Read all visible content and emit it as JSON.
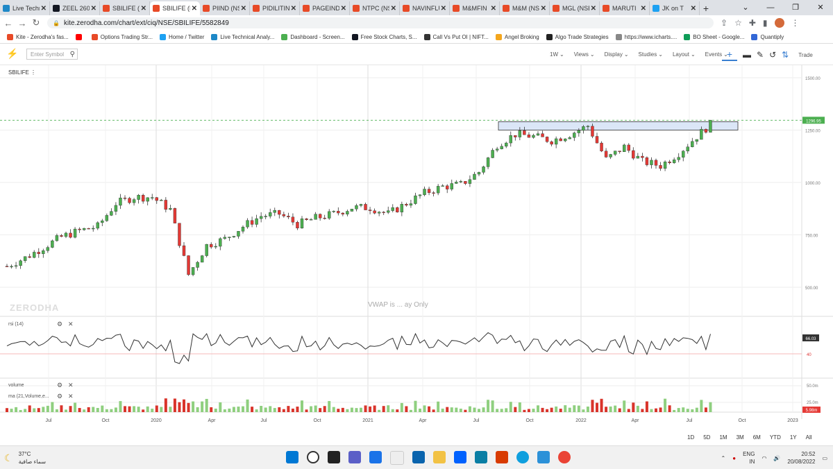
{
  "tabs": [
    {
      "label": "Live Techn",
      "favicon": "bookmark",
      "color": "#1e88c7",
      "active": false
    },
    {
      "label": "ZEEL 260",
      "favicon": "tradingview",
      "color": "#131722",
      "active": false
    },
    {
      "label": "SBILIFE (N",
      "favicon": "kite",
      "color": "#e84a27",
      "active": false
    },
    {
      "label": "SBILIFE (N",
      "favicon": "kite",
      "color": "#e84a27",
      "active": true
    },
    {
      "label": "PIIND (NS",
      "favicon": "kite",
      "color": "#e84a27",
      "active": false
    },
    {
      "label": "PIDILITIN",
      "favicon": "kite",
      "color": "#e84a27",
      "active": false
    },
    {
      "label": "PAGEIND",
      "favicon": "kite",
      "color": "#e84a27",
      "active": false
    },
    {
      "label": "NTPC (NS",
      "favicon": "kite",
      "color": "#e84a27",
      "active": false
    },
    {
      "label": "NAVINFLU",
      "favicon": "kite",
      "color": "#e84a27",
      "active": false
    },
    {
      "label": "M&MFIN",
      "favicon": "kite",
      "color": "#e84a27",
      "active": false
    },
    {
      "label": "M&M (NS",
      "favicon": "kite",
      "color": "#e84a27",
      "active": false
    },
    {
      "label": "MGL (NSE",
      "favicon": "kite",
      "color": "#e84a27",
      "active": false
    },
    {
      "label": "MARUTI",
      "favicon": "kite",
      "color": "#e84a27",
      "active": false
    },
    {
      "label": "JK on T",
      "favicon": "twitter",
      "color": "#1da1f2",
      "active": false
    }
  ],
  "address": {
    "url": "kite.zerodha.com/chart/ext/ciq/NSE/SBILIFE/5582849"
  },
  "bookmarks": [
    {
      "label": "Kite - Zerodha's fas...",
      "color": "#e84a27"
    },
    {
      "label": "",
      "color": "#ff0000"
    },
    {
      "label": "Options Trading Str...",
      "color": "#e84a27"
    },
    {
      "label": "Home / Twitter",
      "color": "#1da1f2"
    },
    {
      "label": "Live Technical Analy...",
      "color": "#1e88c7"
    },
    {
      "label": "Dashboard - Screen...",
      "color": "#4caf50"
    },
    {
      "label": "Free Stock Charts, S...",
      "color": "#131722"
    },
    {
      "label": "Call Vs Put OI | NIFT...",
      "color": "#333333"
    },
    {
      "label": "Angel Broking",
      "color": "#f4a61d"
    },
    {
      "label": "Algo Trade Strategies",
      "color": "#222222"
    },
    {
      "label": "https://www.icharts....",
      "color": "#888888"
    },
    {
      "label": "BO Sheet - Google...",
      "color": "#0f9d58"
    },
    {
      "label": "Quantiply",
      "color": "#3367d6"
    }
  ],
  "kite": {
    "search_placeholder": "Enter Symbol",
    "menus": [
      "1W",
      "Views",
      "Display",
      "Studies",
      "Layout",
      "Events"
    ],
    "trade_label": "Trade",
    "symbol": "SBILIFE",
    "watermark": "ZERODHA",
    "vwap_note": "VWAP is ... ay Only"
  },
  "chart_data": {
    "type": "candlestick",
    "title": "SBILIFE",
    "interval": "1W",
    "price_axis": {
      "ticks": [
        1500,
        1250,
        1000,
        750,
        500
      ],
      "labels": [
        "1500.00",
        "1250.00",
        "1000.00",
        "750.00",
        "500.00"
      ]
    },
    "last_price": 1296.95,
    "x_labels": [
      "Jul",
      "Oct",
      "2020",
      "Apr",
      "Jul",
      "Oct",
      "2021",
      "Apr",
      "Jul",
      "Oct",
      "2022",
      "Apr",
      "Jul",
      "Oct",
      "2023"
    ],
    "resistance_zone": [
      1250,
      1290
    ],
    "close_path": [
      {
        "date": "2019-05",
        "price": 600
      },
      {
        "date": "2019-06",
        "price": 640
      },
      {
        "date": "2019-07",
        "price": 690
      },
      {
        "date": "2019-08",
        "price": 740
      },
      {
        "date": "2019-09",
        "price": 770
      },
      {
        "date": "2019-10",
        "price": 790
      },
      {
        "date": "2019-11",
        "price": 900
      },
      {
        "date": "2019-12",
        "price": 930
      },
      {
        "date": "2020-01",
        "price": 930
      },
      {
        "date": "2020-02",
        "price": 870
      },
      {
        "date": "2020-03",
        "price": 560
      },
      {
        "date": "2020-04",
        "price": 700
      },
      {
        "date": "2020-05",
        "price": 730
      },
      {
        "date": "2020-06",
        "price": 790
      },
      {
        "date": "2020-07",
        "price": 840
      },
      {
        "date": "2020-08",
        "price": 850
      },
      {
        "date": "2020-09",
        "price": 800
      },
      {
        "date": "2020-10",
        "price": 830
      },
      {
        "date": "2020-11",
        "price": 850
      },
      {
        "date": "2020-12",
        "price": 880
      },
      {
        "date": "2021-01",
        "price": 880
      },
      {
        "date": "2021-02",
        "price": 850
      },
      {
        "date": "2021-03",
        "price": 900
      },
      {
        "date": "2021-04",
        "price": 950
      },
      {
        "date": "2021-05",
        "price": 980
      },
      {
        "date": "2021-06",
        "price": 990
      },
      {
        "date": "2021-07",
        "price": 1050
      },
      {
        "date": "2021-08",
        "price": 1180
      },
      {
        "date": "2021-09",
        "price": 1230
      },
      {
        "date": "2021-10",
        "price": 1220
      },
      {
        "date": "2021-11",
        "price": 1200
      },
      {
        "date": "2021-12",
        "price": 1230
      },
      {
        "date": "2022-01",
        "price": 1270
      },
      {
        "date": "2022-02",
        "price": 1110
      },
      {
        "date": "2022-03",
        "price": 1170
      },
      {
        "date": "2022-04",
        "price": 1100
      },
      {
        "date": "2022-05",
        "price": 1080
      },
      {
        "date": "2022-06",
        "price": 1140
      },
      {
        "date": "2022-07",
        "price": 1220
      },
      {
        "date": "2022-08",
        "price": 1296.95
      }
    ],
    "rsi": {
      "label": "rsi (14)",
      "last": 66.03,
      "last_label": "66.03",
      "level_label": "40"
    },
    "volume": {
      "label": "volume",
      "ma_label": "ma (21,Volume,e...",
      "ticks": [
        "50.0m",
        "25.0m"
      ],
      "last_label": "5.98m"
    }
  },
  "ranges": [
    "1D",
    "5D",
    "1M",
    "3M",
    "6M",
    "YTD",
    "1Y",
    "All"
  ],
  "taskbar": {
    "temperature": "37°C",
    "weather": "سماء صافية",
    "lang": "ENG",
    "lang_sub": "IN",
    "time": "20:52",
    "date": "20/08/2022"
  }
}
